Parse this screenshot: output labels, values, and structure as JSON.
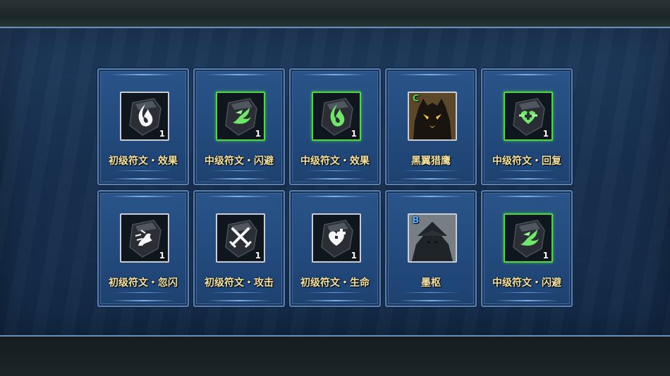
{
  "items": [
    {
      "name": "初级符文・效果",
      "qty": "1",
      "icon": "white-flame-rune-icon",
      "rarity": "white",
      "badge": ""
    },
    {
      "name": "中级符文・闪避",
      "qty": "1",
      "icon": "green-dodge-rune-icon",
      "rarity": "green",
      "badge": ""
    },
    {
      "name": "中级符文・效果",
      "qty": "1",
      "icon": "green-flame-rune-icon",
      "rarity": "green",
      "badge": ""
    },
    {
      "name": "黑翼猎鹰",
      "qty": "",
      "icon": "black-wing-falcon-portrait-icon",
      "rarity": "white",
      "badge": "C"
    },
    {
      "name": "中级符文・回复",
      "qty": "1",
      "icon": "green-heal-rune-icon",
      "rarity": "green",
      "badge": ""
    },
    {
      "name": "初级符文・忽闪",
      "qty": "1",
      "icon": "white-blink-rune-icon",
      "rarity": "white",
      "badge": ""
    },
    {
      "name": "初级符文・攻击",
      "qty": "1",
      "icon": "white-swords-rune-icon",
      "rarity": "white",
      "badge": ""
    },
    {
      "name": "初级符文・生命",
      "qty": "1",
      "icon": "white-life-rune-icon",
      "rarity": "white",
      "badge": ""
    },
    {
      "name": "墨枢",
      "qty": "",
      "icon": "mo-shu-portrait-icon",
      "rarity": "white",
      "badge": "B"
    },
    {
      "name": "中级符文・闪避",
      "qty": "1",
      "icon": "green-dodge-rune-icon",
      "rarity": "green",
      "badge": ""
    }
  ],
  "colors": {
    "name_text": "#f6e3a0",
    "green_rarity": "#4fd64a",
    "white_rarity": "#c9ced6",
    "badge_c": "#4fd64a",
    "badge_b": "#4aa8ff"
  }
}
